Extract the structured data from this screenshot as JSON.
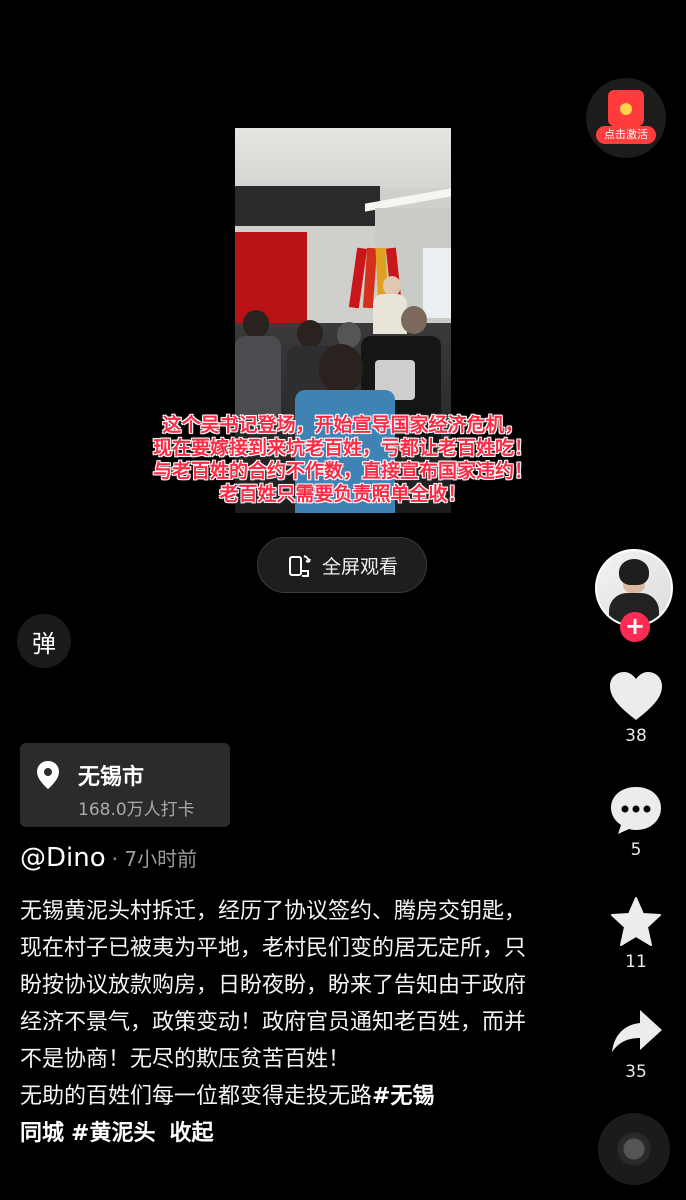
{
  "video": {
    "caption_lines": [
      "这个吴书记登场，开始宣导国家经济危机，",
      "现在要嫁接到来坑老百姓，亏都让老百姓吃！",
      "与老百姓的合约不作数，直接宣布国家违约！",
      "老百姓只需要负责照单全收！"
    ],
    "fullscreen_label": "全屏观看"
  },
  "danmaku_label": "弹",
  "red_packet_label": "点击激活",
  "actions": {
    "likes": "38",
    "comments": "5",
    "favorites": "11",
    "shares": "35",
    "follow_symbol": "+"
  },
  "location": {
    "city": "无锡市",
    "checkins": "168.0万人打卡"
  },
  "post": {
    "author": "@Dino",
    "time": "· 7小时前",
    "text": "无锡黄泥头村拆迁，经历了协议签约、腾房交钥匙，现在村子已被夷为平地，老村民们变的居无定所，只盼按协议放款购房，日盼夜盼，盼来了告知由于政府经济不景气，政策变动！政府官员通知老百姓，而并不是协商！无尽的欺压贫苦百姓！",
    "text2": "无助的百姓们每一位都变得走投无路",
    "hashtag1": "#无锡",
    "hashtag1_tail": "同城",
    "hashtag2": "#黄泥头",
    "collapse_label": "收起"
  },
  "colors": {
    "caption": "#ff2b45",
    "follow_badge": "#fe2c55",
    "background": "#000000"
  }
}
